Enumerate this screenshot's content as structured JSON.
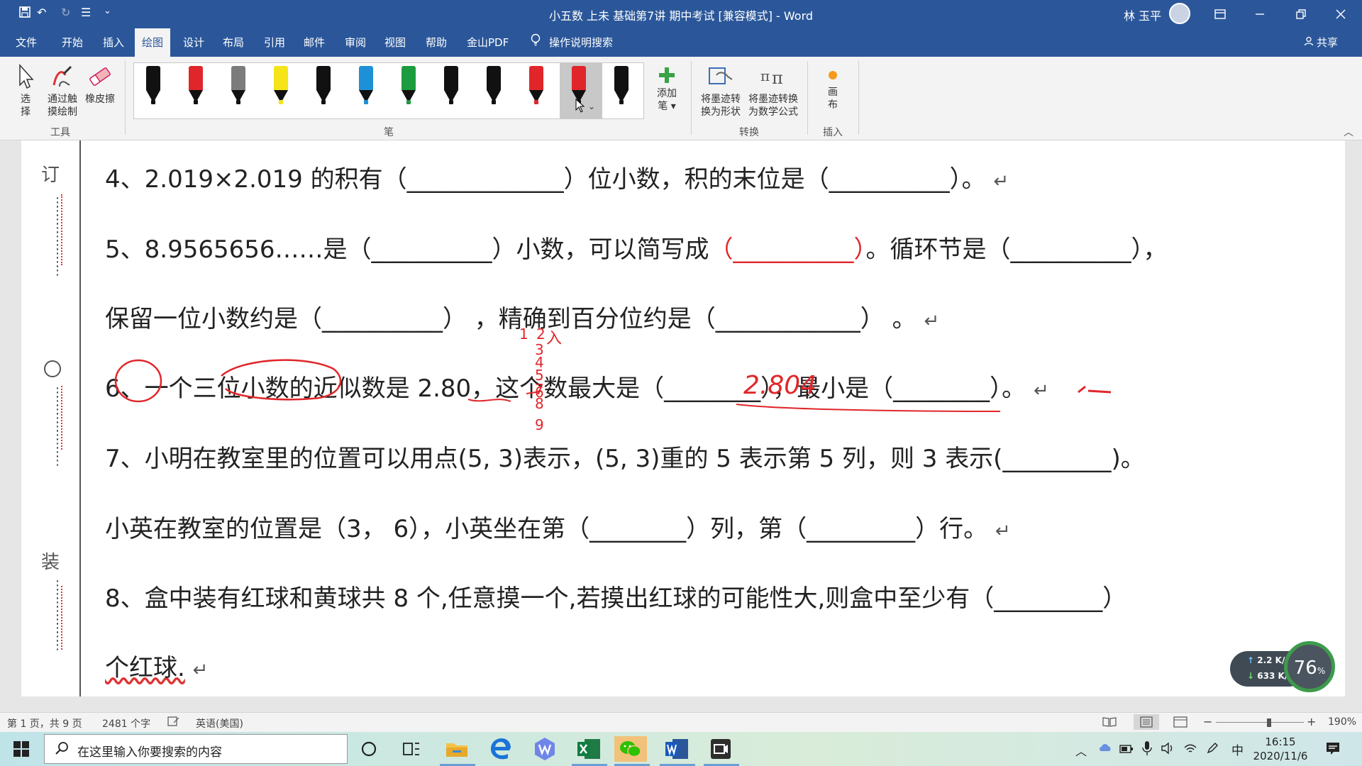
{
  "window": {
    "title": "小五数 上未  基础第7讲 期中考试 [兼容模式] - Word",
    "user_name": "林 玉平",
    "qa_undo": "↶",
    "qa_redo": "↻",
    "qa_menu": "☰",
    "qa_more": "⌄"
  },
  "tabs": [
    "文件",
    "开始",
    "插入",
    "绘图",
    "设计",
    "布局",
    "引用",
    "邮件",
    "审阅",
    "视图",
    "帮助",
    "金山PDF"
  ],
  "active_tab": "绘图",
  "tell_me": "操作说明搜索",
  "share": "共享",
  "ribbon": {
    "tools": {
      "select": "选\n择",
      "touch_draw": "通过触\n摸绘制",
      "eraser": "橡皮擦",
      "group": "工具"
    },
    "pens": {
      "group": "笔",
      "items": [
        {
          "body": "#111111",
          "nib": "#111111"
        },
        {
          "body": "#e0262a",
          "nib": "#111111"
        },
        {
          "body": "#7c7c7c",
          "nib": "#111111"
        },
        {
          "body": "#f5e418",
          "nib": "#f5e418"
        },
        {
          "body": "#111111",
          "nib": "#111111"
        },
        {
          "body": "#1e90d6",
          "nib": "#1e90d6"
        },
        {
          "body": "#1c9c3e",
          "nib": "#1c9c3e"
        },
        {
          "body": "#111111",
          "nib": "#111111"
        },
        {
          "body": "#111111",
          "nib": "#111111"
        },
        {
          "body": "#e0262a",
          "nib": "#e0262a"
        },
        {
          "body": "#e0262a",
          "nib": "#111111"
        },
        {
          "body": "#111111",
          "nib": "#111111"
        }
      ],
      "add_pen": "添加\n笔 ▾"
    },
    "convert": {
      "to_shape": "将墨迹转\n换为形状",
      "to_math": "将墨迹转换\n为数学公式",
      "group": "转换"
    },
    "insert": {
      "canvas": "画\n布",
      "group": "插入"
    }
  },
  "document": {
    "binding": {
      "char_top": "订",
      "char_bottom": "装"
    },
    "lines": {
      "q4": {
        "text": "4、2.019×2.019 的积有（_____________）位小数，积的末位是（__________）。",
        "mark": "↵"
      },
      "q5a": {
        "pre": "5、8.9565656……是（__________）小数，可以简写成",
        "red": "（__________）",
        "post": "。循环节是（__________），"
      },
      "q5b": {
        "text": "保留一位小数约是（__________）  ，精确到百分位约是（____________）  。",
        "mark": "↵"
      },
      "q6": {
        "text": "6、一个三位小数的近似数是 2.80，这个数最大是（________），最小是（________）。",
        "mark": "↵"
      },
      "q7a": {
        "text": "7、小明在教室里的位置可以用点(5, 3)表示，(5, 3)重的 5 表示第 5 列，则 3 表示(_________)。"
      },
      "q7b": {
        "text": "小英在教室的位置是（3， 6），小英坐在第（________）列，第（_________）行。",
        "mark": "↵"
      },
      "q8a": {
        "text": "8、盒中装有红球和黄球共 8 个,任意摸一个,若摸出红球的可能性大,则盒中至少有（_________）"
      },
      "q8b": {
        "text": "个红球.",
        "mark": "↵"
      }
    },
    "ink": {
      "answer_max": "2.804",
      "scribble_digits": [
        "1",
        "2",
        "3",
        "4",
        "5",
        "6",
        "7",
        "8",
        "9"
      ],
      "scribble_label": "入"
    }
  },
  "net_widget": {
    "up": "2.2 K/s",
    "down": "633 K/s",
    "percent": "76",
    "percent_unit": "%"
  },
  "status": {
    "page": "第 1 页，共 9 页",
    "words": "2481 个字",
    "language": "英语(美国)",
    "zoom": "190%",
    "zoom_minus": "−",
    "zoom_plus": "+"
  },
  "taskbar": {
    "search_placeholder": "在这里输入你要搜索的内容",
    "time": "16:15",
    "date": "2020/11/6",
    "ime": "中"
  }
}
